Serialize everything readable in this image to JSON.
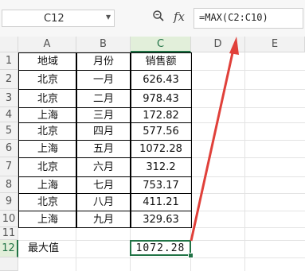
{
  "formula_bar": {
    "name_box": "C12",
    "zoom_icon": "zoom-icon",
    "fx_label": "fx",
    "formula": "=MAX(C2:C10)"
  },
  "columns": [
    "A",
    "B",
    "C",
    "D",
    "E"
  ],
  "rows": [
    "1",
    "2",
    "3",
    "4",
    "5",
    "6",
    "7",
    "8",
    "9",
    "10",
    "11",
    "12"
  ],
  "table": {
    "header": [
      "地域",
      "月份",
      "销售额"
    ],
    "rows": [
      [
        "北京",
        "一月",
        "626.43"
      ],
      [
        "北京",
        "二月",
        "978.43"
      ],
      [
        "上海",
        "三月",
        "172.82"
      ],
      [
        "北京",
        "四月",
        "577.56"
      ],
      [
        "上海",
        "五月",
        "1072.28"
      ],
      [
        "北京",
        "六月",
        "312.2"
      ],
      [
        "上海",
        "七月",
        "753.17"
      ],
      [
        "北京",
        "八月",
        "411.21"
      ],
      [
        "上海",
        "九月",
        "329.63"
      ]
    ]
  },
  "max_row": {
    "label": "最大值",
    "value": "1072.28"
  },
  "annotation_color": "#e0403a",
  "accent_color": "#217346"
}
